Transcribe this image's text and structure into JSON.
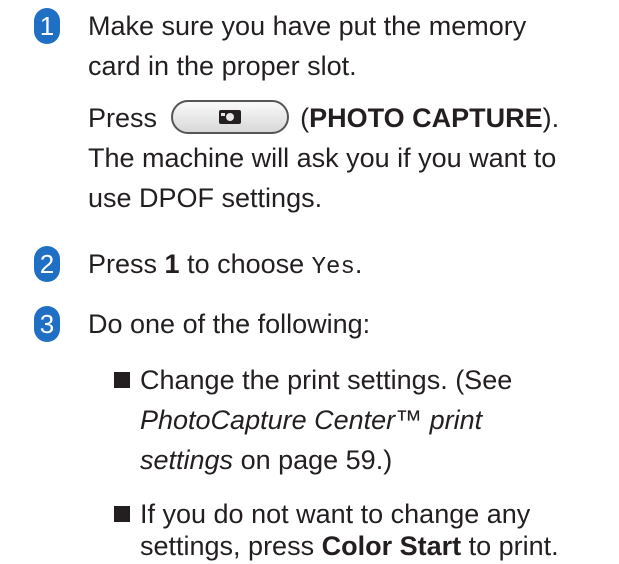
{
  "steps": [
    {
      "number": "1",
      "line1": "Make sure you have put the memory",
      "line2": "card in the proper slot.",
      "press_prefix": "Press",
      "press_label": "PHOTO CAPTURE",
      "press_open": "(",
      "press_close": ").",
      "line4": "The machine will ask you if you want to",
      "line5": "use DPOF settings."
    },
    {
      "number": "2",
      "prefix": "Press ",
      "key": "1",
      "middle": " to choose ",
      "option": "Yes",
      "suffix": "."
    },
    {
      "number": "3",
      "text": "Do one of the following:",
      "bullets": [
        {
          "line1": "Change the print settings. (See",
          "link_part1": "PhotoCapture Center™ print",
          "link_part2": "settings",
          "tail": " on page 59.)"
        },
        {
          "line1": "If you do not want to change any",
          "line2_prefix": "settings, press ",
          "line2_bold": "Color Start",
          "line2_suffix": " to print."
        }
      ]
    }
  ],
  "icons": {
    "photo_capture_button": "camera-icon"
  },
  "colors": {
    "badge": "#1f6fc4",
    "text": "#231f20"
  }
}
